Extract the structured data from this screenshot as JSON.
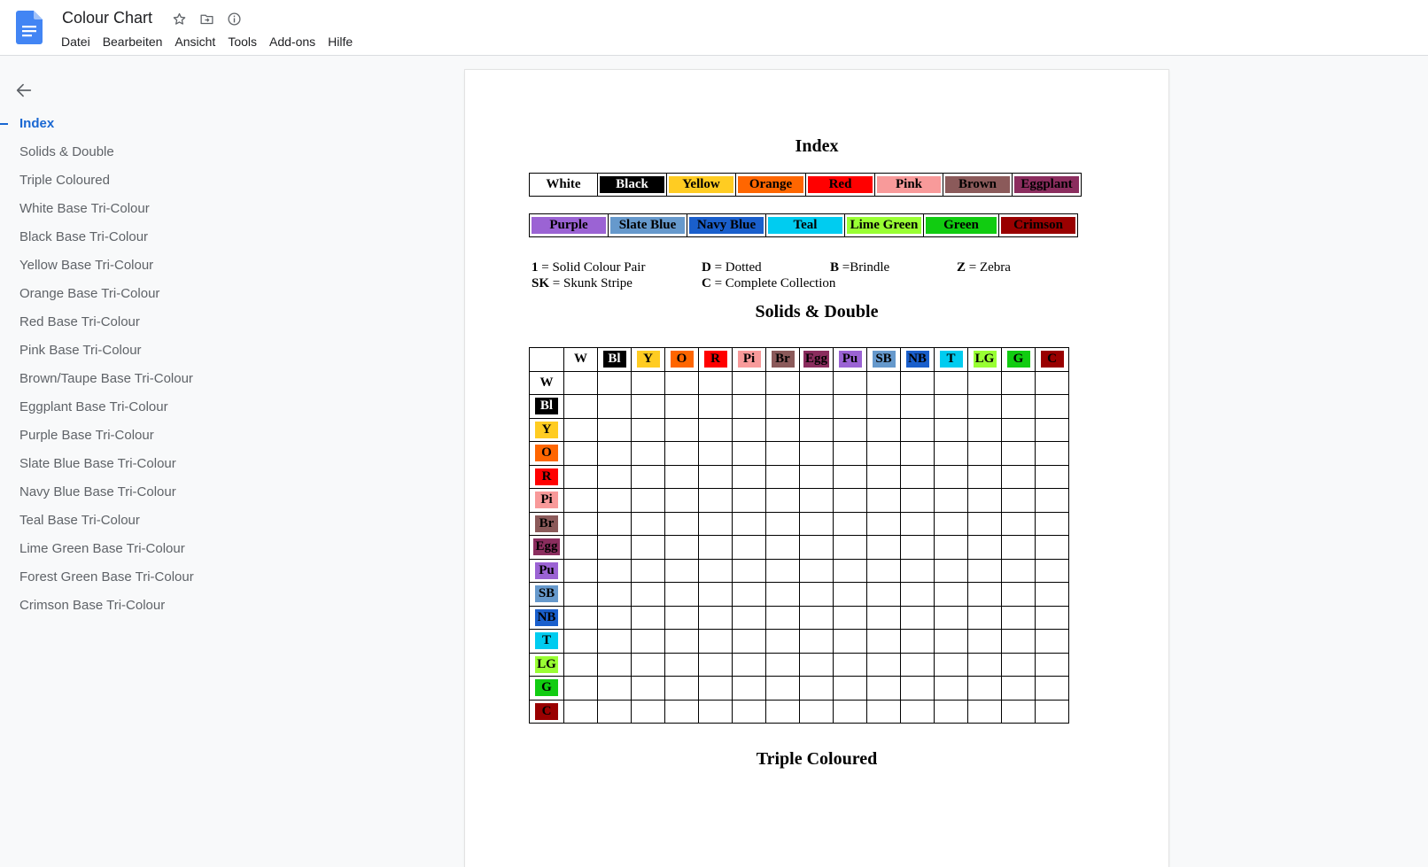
{
  "doc": {
    "title": "Colour Chart",
    "menu": [
      "Datei",
      "Bearbeiten",
      "Ansicht",
      "Tools",
      "Add-ons",
      "Hilfe"
    ]
  },
  "outline": {
    "active_index": 0,
    "items": [
      "Index",
      "Solids & Double",
      "Triple Coloured",
      "White Base Tri-Colour",
      "Black Base Tri-Colour",
      "Yellow Base Tri-Colour",
      "Orange Base Tri-Colour",
      "Red Base Tri-Colour",
      "Pink Base Tri-Colour",
      "Brown/Taupe Base Tri-Colour",
      "Eggplant Base Tri-Colour",
      "Purple Base Tri-Colour",
      "Slate Blue Base Tri-Colour",
      "Navy Blue Base Tri-Colour",
      "Teal Base Tri-Colour",
      "Lime Green Base Tri-Colour",
      "Forest Green Base Tri-Colour",
      "Crimson Base Tri-Colour"
    ]
  },
  "page": {
    "index_heading": "Index",
    "solids_heading": "Solids & Double",
    "triple_heading": "Triple Coloured",
    "swatch_row1": [
      {
        "label": "White",
        "color": "#ffffff",
        "text": "#000000"
      },
      {
        "label": "Black",
        "color": "#000000",
        "text": "#ffffff"
      },
      {
        "label": "Yellow",
        "color": "#ffcc22",
        "text": "#000000"
      },
      {
        "label": "Orange",
        "color": "#ff6600",
        "text": "#000000"
      },
      {
        "label": "Red",
        "color": "#ff0000",
        "text": "#000000"
      },
      {
        "label": "Pink",
        "color": "#f89a9a",
        "text": "#000000"
      },
      {
        "label": "Brown",
        "color": "#8b5a5a",
        "text": "#000000"
      },
      {
        "label": "Eggplant",
        "color": "#8b2d5e",
        "text": "#000000"
      }
    ],
    "swatch_row2": [
      {
        "label": "Purple",
        "color": "#9b63d4",
        "text": "#000000"
      },
      {
        "label": "Slate Blue",
        "color": "#6699cc",
        "text": "#000000"
      },
      {
        "label": "Navy Blue",
        "color": "#1a5fcc",
        "text": "#000000"
      },
      {
        "label": "Teal",
        "color": "#00ccf0",
        "text": "#000000"
      },
      {
        "label": "Lime Green",
        "color": "#99ff33",
        "text": "#000000"
      },
      {
        "label": "Green",
        "color": "#11cc11",
        "text": "#000000"
      },
      {
        "label": "Crimson",
        "color": "#990000",
        "text": "#000000"
      }
    ],
    "legend": [
      {
        "key": "1",
        "desc": " = Solid Colour Pair"
      },
      {
        "key": "D",
        "desc": " = Dotted"
      },
      {
        "key": "B",
        "desc": " =Brindle"
      },
      {
        "key": "Z",
        "desc": " = Zebra"
      },
      {
        "key": "SK",
        "desc": " = Skunk Stripe"
      },
      {
        "key": "C",
        "desc": " = Complete Collection"
      }
    ],
    "grid_codes": [
      {
        "code": "W",
        "color": "#ffffff",
        "text": "#000000"
      },
      {
        "code": "Bl",
        "color": "#000000",
        "text": "#ffffff"
      },
      {
        "code": "Y",
        "color": "#ffcc22",
        "text": "#000000"
      },
      {
        "code": "O",
        "color": "#ff6600",
        "text": "#000000"
      },
      {
        "code": "R",
        "color": "#ff0000",
        "text": "#000000"
      },
      {
        "code": "Pi",
        "color": "#f89a9a",
        "text": "#000000"
      },
      {
        "code": "Br",
        "color": "#8b5a5a",
        "text": "#000000"
      },
      {
        "code": "Egg",
        "color": "#8b2d5e",
        "text": "#000000"
      },
      {
        "code": "Pu",
        "color": "#9b63d4",
        "text": "#000000"
      },
      {
        "code": "SB",
        "color": "#6699cc",
        "text": "#000000"
      },
      {
        "code": "NB",
        "color": "#1a5fcc",
        "text": "#000000"
      },
      {
        "code": "T",
        "color": "#00ccf0",
        "text": "#000000"
      },
      {
        "code": "LG",
        "color": "#99ff33",
        "text": "#000000"
      },
      {
        "code": "G",
        "color": "#11cc11",
        "text": "#000000"
      },
      {
        "code": "C",
        "color": "#990000",
        "text": "#000000"
      }
    ]
  }
}
